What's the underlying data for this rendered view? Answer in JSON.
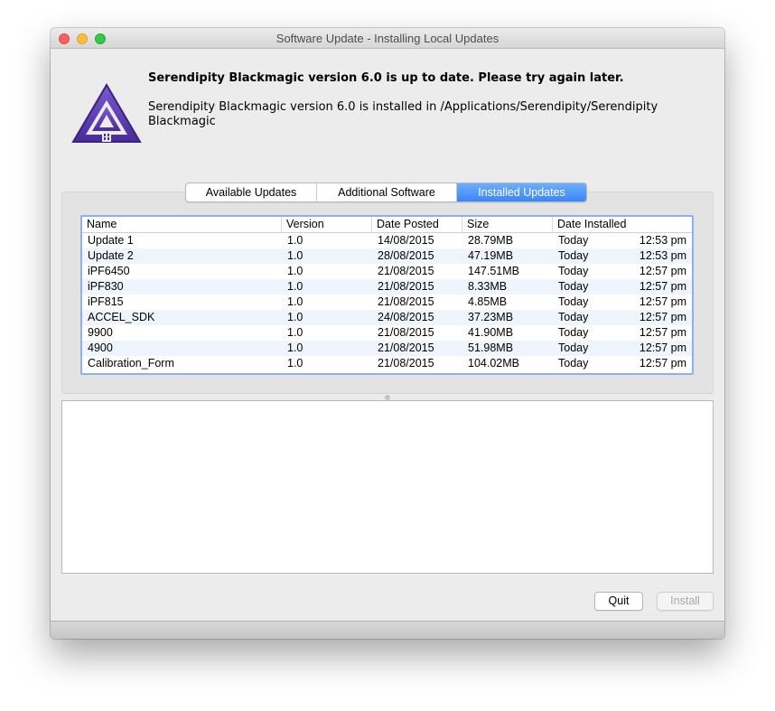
{
  "window": {
    "title": "Software Update - Installing Local Updates"
  },
  "header": {
    "headline": "Serendipity Blackmagic version 6.0 is up to date. Please try again later.",
    "subline": "Serendipity Blackmagic version 6.0 is installed in /Applications/Serendipity/Serendipity Blackmagic",
    "icon": "serendipity-blackmagic-logo"
  },
  "tabs": [
    {
      "label": "Available Updates",
      "selected": false
    },
    {
      "label": "Additional Software",
      "selected": false
    },
    {
      "label": "Installed Updates",
      "selected": true
    }
  ],
  "table": {
    "columns": [
      "Name",
      "Version",
      "Date Posted",
      "Size",
      "Date Installed"
    ],
    "rows": [
      {
        "name": "Update 1",
        "version": "1.0",
        "posted": "14/08/2015",
        "size": "28.79MB",
        "installed_day": "Today",
        "installed_time": "12:53 pm"
      },
      {
        "name": "Update 2",
        "version": "1.0",
        "posted": "28/08/2015",
        "size": "47.19MB",
        "installed_day": "Today",
        "installed_time": "12:53 pm"
      },
      {
        "name": "iPF6450",
        "version": "1.0",
        "posted": "21/08/2015",
        "size": "147.51MB",
        "installed_day": "Today",
        "installed_time": "12:57 pm"
      },
      {
        "name": "iPF830",
        "version": "1.0",
        "posted": "21/08/2015",
        "size": "8.33MB",
        "installed_day": "Today",
        "installed_time": "12:57 pm"
      },
      {
        "name": "iPF815",
        "version": "1.0",
        "posted": "21/08/2015",
        "size": "4.85MB",
        "installed_day": "Today",
        "installed_time": "12:57 pm"
      },
      {
        "name": "ACCEL_SDK",
        "version": "1.0",
        "posted": "24/08/2015",
        "size": "37.23MB",
        "installed_day": "Today",
        "installed_time": "12:57 pm"
      },
      {
        "name": "9900",
        "version": "1.0",
        "posted": "21/08/2015",
        "size": "41.90MB",
        "installed_day": "Today",
        "installed_time": "12:57 pm"
      },
      {
        "name": "4900",
        "version": "1.0",
        "posted": "21/08/2015",
        "size": "51.98MB",
        "installed_day": "Today",
        "installed_time": "12:57 pm"
      },
      {
        "name": "Calibration_Form",
        "version": "1.0",
        "posted": "21/08/2015",
        "size": "104.02MB",
        "installed_day": "Today",
        "installed_time": "12:57 pm"
      }
    ]
  },
  "buttons": {
    "quit": "Quit",
    "install": "Install"
  },
  "colors": {
    "accent": "#3a85f9",
    "logo_purple": "#5a3aa8"
  }
}
